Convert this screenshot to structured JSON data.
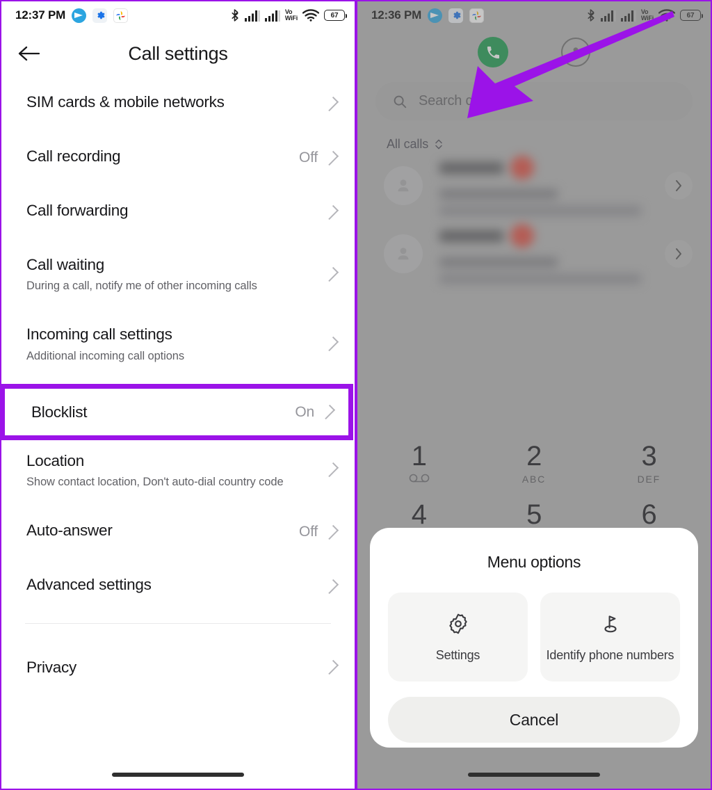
{
  "annotation": {
    "highlight_color": "#9b13e8",
    "arrow_color": "#9b13e8"
  },
  "left_panel": {
    "status_bar": {
      "time": "12:37 PM",
      "app_icons": [
        "telegram-icon",
        "settings-gear-icon",
        "google-photos-icon"
      ],
      "right_icons": [
        "bluetooth-icon",
        "signal-sim1-icon",
        "signal-sim2-icon",
        "vowifi-icon",
        "wifi-icon"
      ],
      "vowifi_top": "Vo",
      "vowifi_bottom": "WiFi",
      "battery_level": "67"
    },
    "appbar": {
      "title": "Call settings",
      "back_icon": "back-arrow-icon"
    },
    "items": [
      {
        "title": "SIM cards & mobile networks",
        "sub": "",
        "value": ""
      },
      {
        "title": "Call recording",
        "sub": "",
        "value": "Off"
      },
      {
        "title": "Call forwarding",
        "sub": "",
        "value": ""
      },
      {
        "title": "Call waiting",
        "sub": "During a call, notify me of other incoming calls",
        "value": ""
      },
      {
        "title": "Incoming call settings",
        "sub": "Additional incoming call options",
        "value": ""
      },
      {
        "title": "Location",
        "sub": "Show contact location, Don't auto-dial country code",
        "value": ""
      },
      {
        "title": "Auto-answer",
        "sub": "",
        "value": "Off"
      },
      {
        "title": "Advanced settings",
        "sub": "",
        "value": ""
      }
    ],
    "highlighted_item": {
      "title": "Blocklist",
      "value": "On"
    },
    "footer_items": [
      {
        "title": "Privacy",
        "sub": "",
        "value": ""
      }
    ]
  },
  "right_panel": {
    "status_bar": {
      "time": "12:36 PM",
      "app_icons": [
        "telegram-icon",
        "settings-gear-icon",
        "google-photos-icon"
      ],
      "right_icons": [
        "bluetooth-icon",
        "signal-sim1-icon",
        "signal-sim2-icon",
        "vowifi-icon",
        "wifi-icon"
      ],
      "vowifi_top": "Vo",
      "vowifi_bottom": "WiFi",
      "battery_level": "67"
    },
    "tabs": [
      {
        "name": "phone-tab",
        "icon": "phone-handset-icon",
        "active": true
      },
      {
        "name": "contacts-tab",
        "icon": "person-icon",
        "active": false
      }
    ],
    "search": {
      "placeholder": "Search contacts",
      "icon": "search-icon"
    },
    "filter": {
      "label": "All calls",
      "icon": "chevron-updown-icon"
    },
    "call_rows": [
      {
        "redacted": true,
        "badge": "missed-call-badge"
      },
      {
        "redacted": true,
        "badge": "missed-call-badge"
      }
    ],
    "dialpad": [
      {
        "num": "1",
        "sub": "",
        "sub_icon": "voicemail-icon"
      },
      {
        "num": "2",
        "sub": "ABC",
        "sub_icon": ""
      },
      {
        "num": "3",
        "sub": "DEF",
        "sub_icon": ""
      },
      {
        "num": "4",
        "sub": "",
        "sub_icon": ""
      },
      {
        "num": "5",
        "sub": "",
        "sub_icon": ""
      },
      {
        "num": "6",
        "sub": "",
        "sub_icon": ""
      }
    ],
    "menu_sheet": {
      "title": "Menu options",
      "cards": [
        {
          "label": "Settings",
          "icon": "gear-icon"
        },
        {
          "label": "Identify phone numbers",
          "icon": "flag-pin-icon"
        }
      ],
      "cancel_label": "Cancel"
    }
  }
}
